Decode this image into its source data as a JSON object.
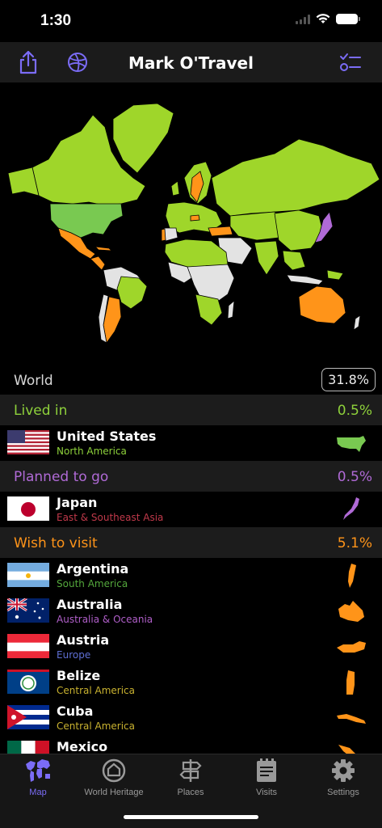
{
  "status_bar": {
    "time": "1:30"
  },
  "nav": {
    "title": "Mark O'Travel"
  },
  "world": {
    "label": "World",
    "percent": "31.8%"
  },
  "sections": {
    "lived": {
      "label": "Lived in",
      "percent": "0.5%",
      "color": "#8ed13b"
    },
    "planned": {
      "label": "Planned to go",
      "percent": "0.5%",
      "color": "#b06ad6"
    },
    "wish": {
      "label": "Wish to visit",
      "percent": "5.1%",
      "color": "#ff9419"
    }
  },
  "lived_rows": [
    {
      "name": "United States",
      "region": "North America",
      "region_color": "#8ed13b"
    }
  ],
  "planned_rows": [
    {
      "name": "Japan",
      "region": "East & Southeast Asia",
      "region_color": "#c0394a"
    }
  ],
  "wish_rows": [
    {
      "name": "Argentina",
      "region": "South America",
      "region_color": "#54a83c"
    },
    {
      "name": "Australia",
      "region": "Australia & Oceania",
      "region_color": "#b05fc9"
    },
    {
      "name": "Austria",
      "region": "Europe",
      "region_color": "#5f6fd4"
    },
    {
      "name": "Belize",
      "region": "Central America",
      "region_color": "#c9b230"
    },
    {
      "name": "Cuba",
      "region": "Central America",
      "region_color": "#c9b230"
    },
    {
      "name": "Mexico",
      "region": "",
      "region_color": "#c9b230"
    }
  ],
  "tabs": [
    {
      "label": "Map",
      "active": true
    },
    {
      "label": "World Heritage",
      "active": false
    },
    {
      "label": "Places",
      "active": false
    },
    {
      "label": "Visits",
      "active": false
    },
    {
      "label": "Settings",
      "active": false
    }
  ],
  "colors": {
    "accent": "#7b6cf6",
    "visited": "#9fd62a",
    "unvisited": "#e3e3e3"
  }
}
